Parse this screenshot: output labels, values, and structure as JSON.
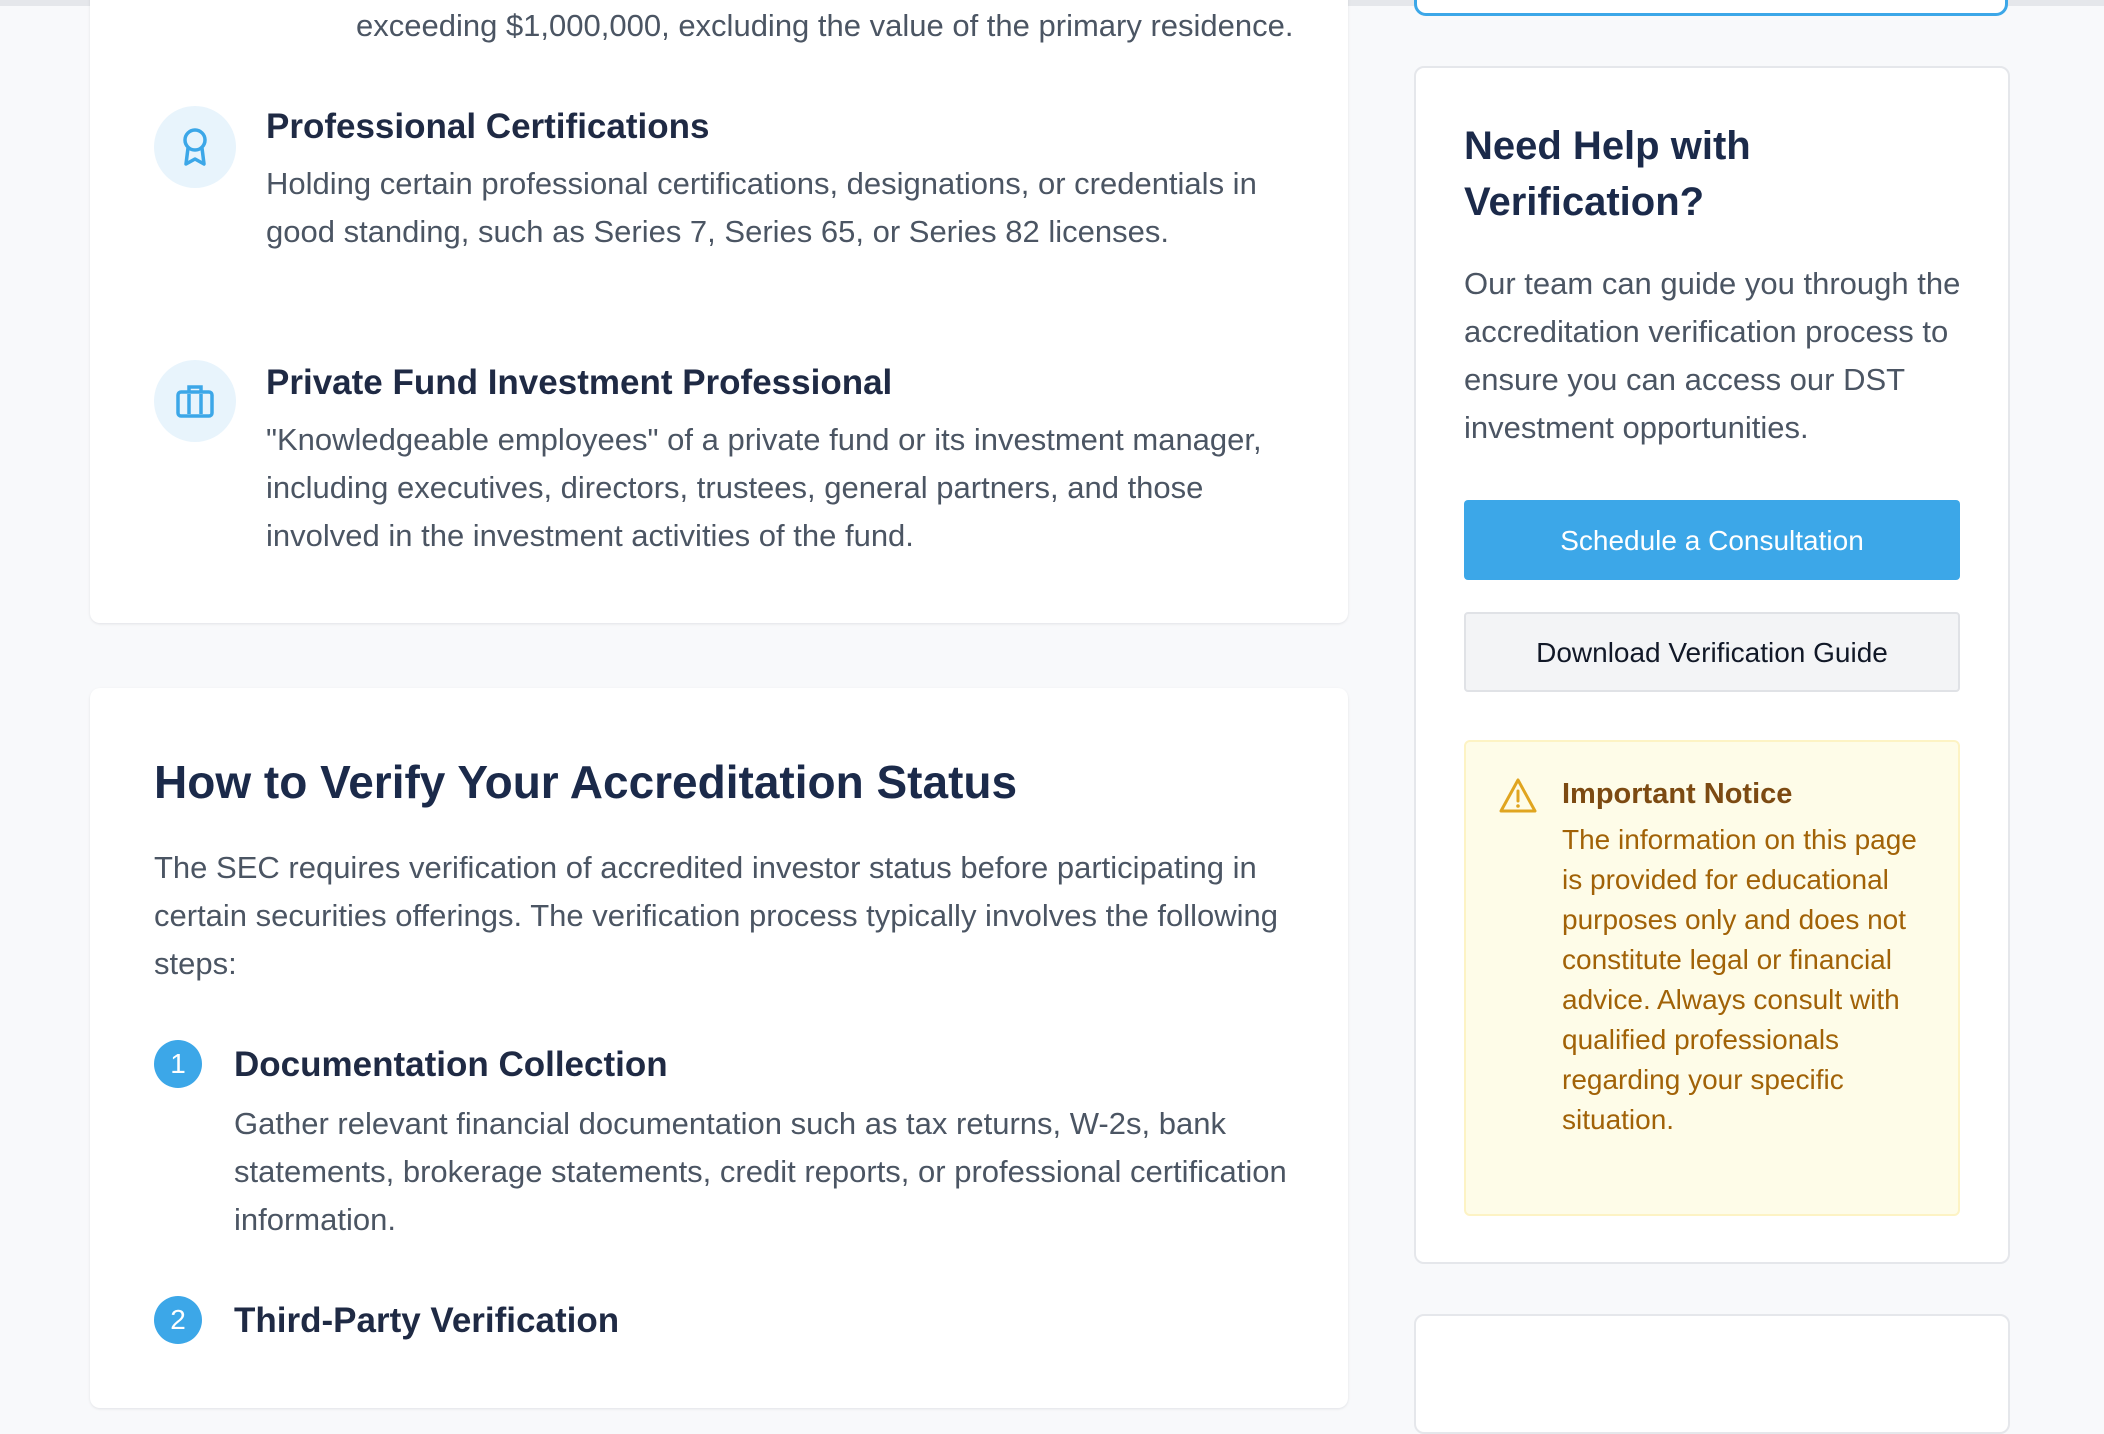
{
  "top_fragment": "exceeding $1,000,000, excluding the value of the primary residence.",
  "criteria": [
    {
      "icon": "award-ribbon-icon",
      "title": "Professional Certifications",
      "description": "Holding certain professional certifications, designations, or credentials in good standing, such as Series 7, Series 65, or Series 82 licenses."
    },
    {
      "icon": "briefcase-icon",
      "title": "Private Fund Investment Professional",
      "description": "\"Knowledgeable employees\" of a private fund or its investment manager, including executives, directors, trustees, general partners, and those involved in the investment activities of the fund."
    }
  ],
  "verify": {
    "title": "How to Verify Your Accreditation Status",
    "intro": "The SEC requires verification of accredited investor status before participating in certain securities offerings. The verification process typically involves the following steps:",
    "steps": [
      {
        "number": "1",
        "title": "Documentation Collection",
        "description": "Gather relevant financial documentation such as tax returns, W-2s, bank statements, brokerage statements, credit reports, or professional certification information."
      },
      {
        "number": "2",
        "title": "Third-Party Verification",
        "description": ""
      }
    ]
  },
  "sidebar": {
    "help_title": "Need Help with Verification?",
    "help_text": "Our team can guide you through the accreditation verification process to ensure you can access our DST investment opportunities.",
    "primary_button": "Schedule a Consultation",
    "secondary_button": "Download Verification Guide",
    "notice": {
      "icon": "warning-triangle-icon",
      "title": "Important Notice",
      "text": "The information on this page is provided for educational purposes only and does not constitute legal or financial advice. Always consult with qualified professionals regarding your specific situation."
    }
  },
  "colors": {
    "accent": "#3ca7e8",
    "heading": "#1b2a4a",
    "body_text": "#4b5563",
    "notice_bg": "#fefce8",
    "notice_text": "#a16207"
  }
}
